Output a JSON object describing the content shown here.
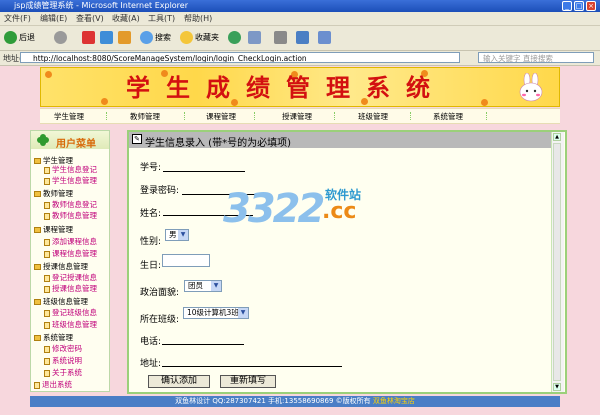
{
  "browser": {
    "title": "jsp成绩管理系统 - Microsoft Internet Explorer",
    "menu": [
      "文件(F)",
      "编辑(E)",
      "查看(V)",
      "收藏(A)",
      "工具(T)",
      "帮助(H)"
    ],
    "toolbar": {
      "back": "后退",
      "search": "搜索",
      "favorites": "收藏夹"
    },
    "address_label": "地址(D)",
    "address": "http://localhost:8080/ScoreManageSystem/login/login_CheckLogin.action",
    "search_placeholder": "输入关键字  直接搜索"
  },
  "banner": {
    "title": "学生成绩管理系统"
  },
  "nav": [
    "学生管理",
    "教师管理",
    "课程管理",
    "授课管理",
    "班级管理",
    "系统管理"
  ],
  "sidebar": {
    "title": "用户菜单",
    "groups": [
      {
        "label": "学生管理",
        "items": [
          "学生信息登记",
          "学生信息管理"
        ]
      },
      {
        "label": "教师管理",
        "items": [
          "教师信息登记",
          "教师信息管理"
        ]
      },
      {
        "label": "课程管理",
        "items": [
          "添加课程信息",
          "课程信息管理"
        ]
      },
      {
        "label": "授课信息管理",
        "items": [
          "登记授课信息",
          "授课信息管理"
        ]
      },
      {
        "label": "班级信息管理",
        "items": [
          "登记班级信息",
          "班级信息管理"
        ]
      },
      {
        "label": "系统管理",
        "items": [
          "修改密码",
          "系统说明",
          "关于系统"
        ]
      }
    ],
    "logout": "退出系统"
  },
  "form": {
    "title": "学生信息录入 (带*号的为必填项)",
    "fields": {
      "student_no": "学号:",
      "password": "登录密码:",
      "name": "姓名:",
      "gender": "性别:",
      "gender_value": "男",
      "birthday": "生日:",
      "politics": "政治面貌:",
      "politics_value": "团员",
      "class": "所在班级:",
      "class_value": "10级计算机3班",
      "phone": "电话:",
      "address": "地址:"
    },
    "submit": "确认添加",
    "reset": "重新填写"
  },
  "watermark": {
    "digits": "3322",
    "cn": "软件站",
    "cc": ".cc"
  },
  "footer": {
    "text": "双鱼林设计  QQ:287307421 手机:13558690869 ©版权所有 ",
    "link": "双鱼林淘宝店"
  },
  "colors": {
    "title_red": "#d31010",
    "banner_yellow": "#ffe26a",
    "footer_blue": "#4a7ec6",
    "page_pink": "#f7d7dd"
  }
}
